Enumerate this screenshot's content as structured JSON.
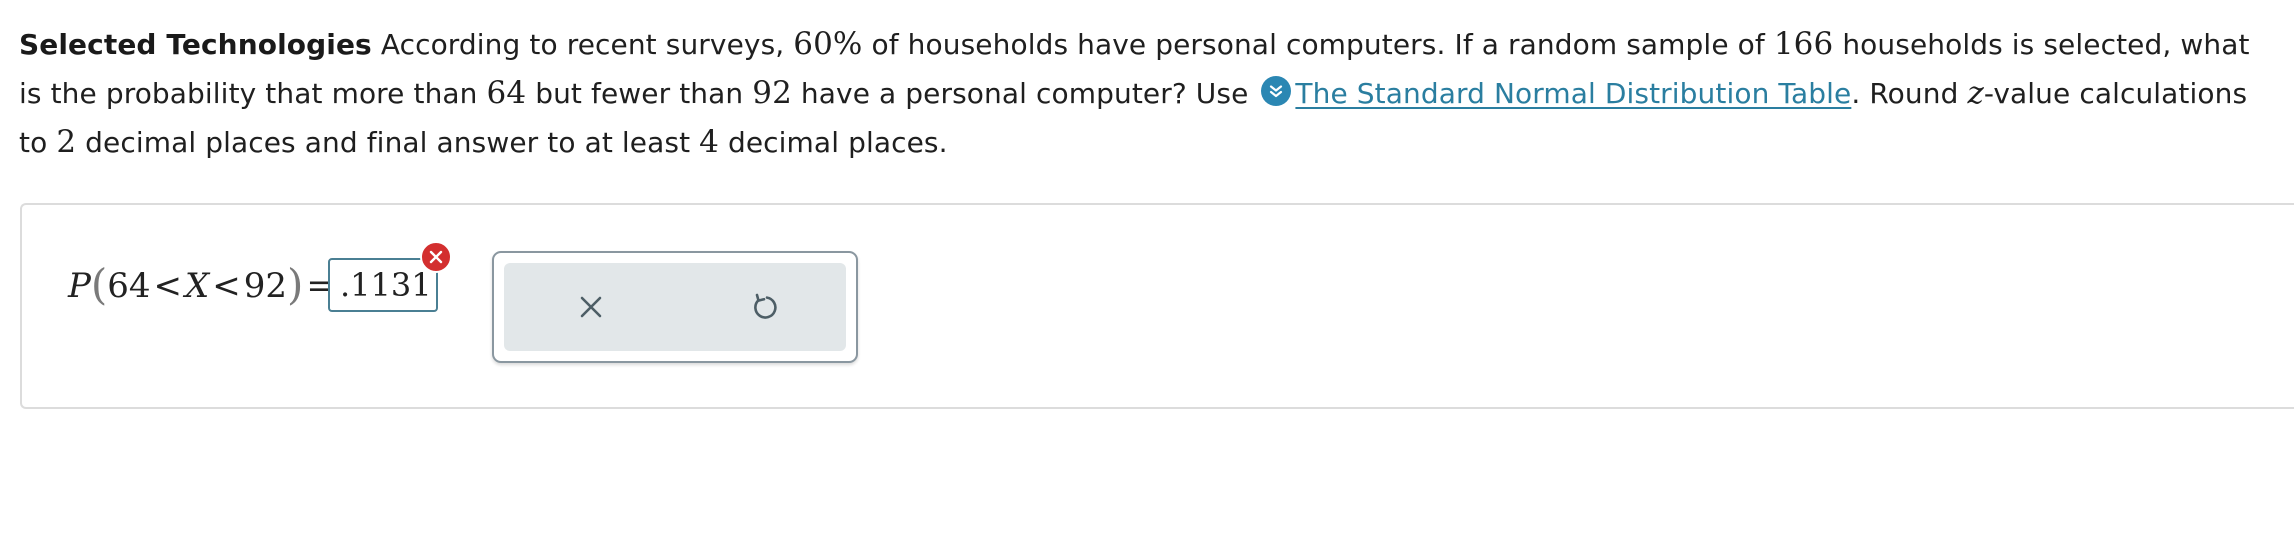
{
  "problem": {
    "title": "Selected Technologies",
    "text_1": " According to recent surveys, ",
    "percent": "60%",
    "text_2": " of households have personal computers. If a random sample of ",
    "sample_size": "166",
    "text_3": " households is selected, what is the probability that more than ",
    "lower": "64",
    "text_4": " but fewer than ",
    "upper": "92",
    "text_5": " have a personal computer? Use ",
    "table_link": "The Standard Normal Distribution Table",
    "text_6": ". Round ",
    "z_var": "z",
    "text_7": "-value calculations to ",
    "z_places": "2",
    "text_8": " decimal places and final answer to at least ",
    "final_places": "4",
    "text_9": " decimal places."
  },
  "answer": {
    "prob_label": "P",
    "open_paren": "(",
    "lower": "64",
    "lt1": "<",
    "var": "X",
    "lt2": "<",
    "upper": "92",
    "close_paren": ")",
    "equals": "=",
    "value": ".1131",
    "status": "incorrect"
  },
  "tools": {
    "clear": "clear-icon",
    "undo": "undo-icon"
  },
  "colors": {
    "link": "#2a7ea0",
    "link_icon_bg": "#2b87b3",
    "error": "#d32f2f",
    "input_border": "#4a7f93",
    "tool_bg": "#e2e7e9"
  }
}
